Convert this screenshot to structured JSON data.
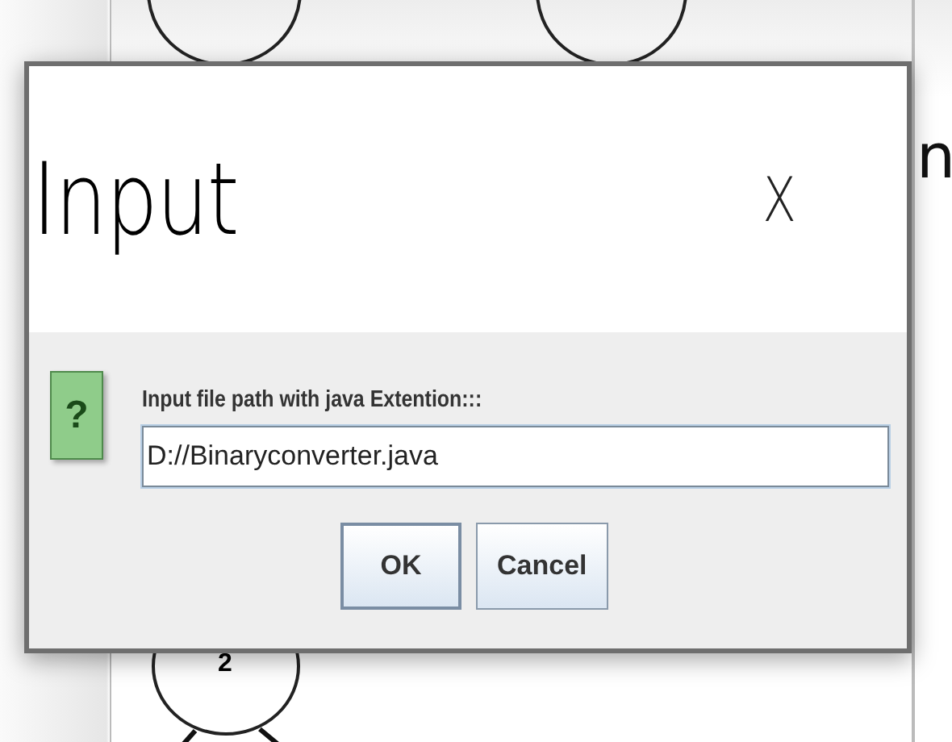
{
  "background": {
    "fragment_text": "n",
    "node_label": "2"
  },
  "dialog": {
    "title": "Input",
    "close": "X",
    "icon": "?",
    "message": "Input file path with java Extention:::",
    "field": {
      "value": "D://Binaryconverter.java",
      "focused": true
    },
    "buttons": [
      {
        "label": "OK",
        "selected": true
      },
      {
        "label": "Cancel",
        "selected": false
      }
    ]
  }
}
